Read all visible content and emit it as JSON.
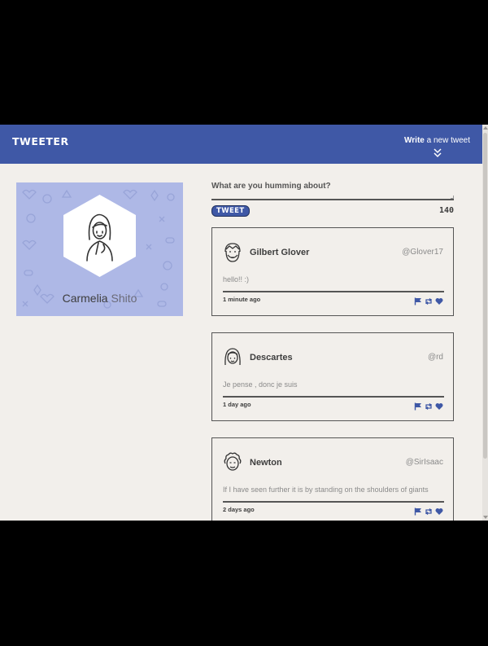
{
  "topbar": {
    "logo": "TWEETER",
    "compose_bold": "Write",
    "compose_rest": " a new tweet",
    "chevron_icon": "double-chevron-down-icon"
  },
  "profile": {
    "first_name": "Carmelia",
    "last_name": "Shito",
    "avatar_icon": "girl-avatar-icon",
    "bg_color": "#aeb8e6"
  },
  "composer": {
    "label": "What are you humming about?",
    "button_label": "TWEET",
    "counter": "140"
  },
  "tweets": [
    {
      "author": "Gilbert Glover",
      "handle": "@Glover17",
      "content": "hello!! :)",
      "time": "1 minute ago",
      "avatar_icon": "bearded-man-avatar-icon"
    },
    {
      "author": "Descartes",
      "handle": "@rd",
      "content": "Je pense , donc je suis",
      "time": "1 day ago",
      "avatar_icon": "long-hair-avatar-icon"
    },
    {
      "author": "Newton",
      "handle": "@SirIsaac",
      "content": "If I have seen further it is by standing on the shoulders of giants",
      "time": "2 days ago",
      "avatar_icon": "curly-hair-avatar-icon"
    }
  ],
  "actions": {
    "flag_icon": "flag-icon",
    "retweet_icon": "retweet-icon",
    "like_icon": "heart-icon"
  },
  "colors": {
    "primary": "#3f58a6",
    "page_bg": "#f2efeb",
    "text_dark": "#3d3d3d",
    "text_muted": "#8a8a8a"
  }
}
